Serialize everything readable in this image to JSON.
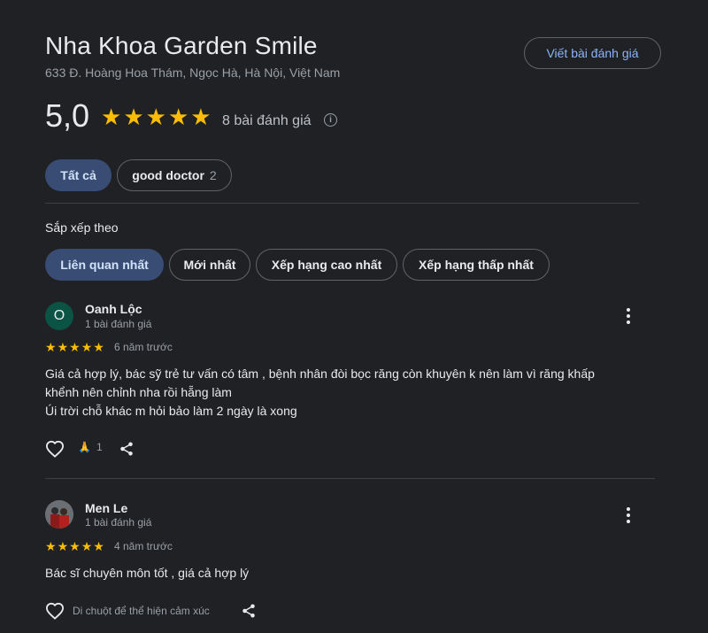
{
  "place": {
    "name": "Nha Khoa Garden Smile",
    "address": "633 Đ. Hoàng Hoa Thám, Ngọc Hà, Hà Nội, Việt Nam",
    "write_review_label": "Viết bài đánh giá",
    "rating": "5,0",
    "star_count": 5,
    "review_count_label": "8 bài đánh giá",
    "info_icon": "info-icon"
  },
  "filters": {
    "all_label": "Tất cả",
    "topic_label": "good doctor",
    "topic_count": "2"
  },
  "sort": {
    "label": "Sắp xếp theo",
    "options": [
      "Liên quan nhất",
      "Mới nhất",
      "Xếp hạng cao nhất",
      "Xếp hạng thấp nhất"
    ],
    "selected": "Liên quan nhất"
  },
  "reviews": [
    {
      "avatar_letter": "O",
      "avatar_color": "#0b5345",
      "name": "Oanh Lộc",
      "meta": "1 bài đánh giá",
      "stars": 5,
      "time": "6 năm trước",
      "text_lines": [
        "Giá cả hợp lý, bác sỹ trẻ tư vấn có tâm , bệnh nhân đòi bọc răng còn khuyên k nên làm vì răng khấp",
        "khểnh nên chỉnh nha rồi hẵng làm",
        "Úi trời chỗ khác m hỏi bảo làm 2 ngày là xong"
      ],
      "reaction_emoji": "🙏",
      "reaction_count": "1"
    },
    {
      "avatar_letter": "",
      "avatar_color": "#5f6368",
      "name": "Men Le",
      "meta": "1 bài đánh giá",
      "stars": 5,
      "time": "4 năm trước",
      "text_lines": [
        "Bác sĩ chuyên môn tốt , giá cả hợp lý"
      ],
      "hover_hint": "Di chuột để thể hiện cảm xúc"
    }
  ],
  "colors": {
    "background": "#202124",
    "star": "#fbbc04",
    "accent": "#8ab4f8",
    "active_chip": "#394d74"
  }
}
